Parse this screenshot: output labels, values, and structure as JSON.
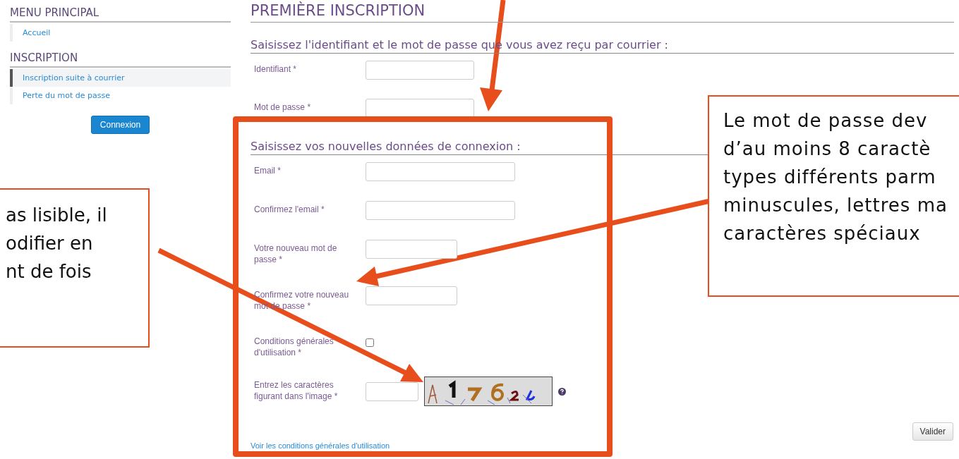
{
  "sidebar": {
    "sections": [
      {
        "title": "MENU PRINCIPAL",
        "items": [
          {
            "label": "Accueil",
            "selected": false
          }
        ]
      },
      {
        "title": "INSCRIPTION",
        "items": [
          {
            "label": "Inscription suite à courrier",
            "selected": true
          },
          {
            "label": "Perte du mot de passe",
            "selected": false
          }
        ]
      }
    ],
    "button": "Connexion"
  },
  "page_title": "PREMIÈRE INSCRIPTION",
  "sections": [
    {
      "heading": "Saisissez l'identifiant et le mot de passe que vous avez reçu par courrier :",
      "fields": [
        {
          "label": "Identifiant *",
          "kind": "login"
        },
        {
          "label": "Mot de passe *",
          "kind": "login"
        }
      ]
    },
    {
      "heading": "Saisissez vos nouvelles données de connexion :",
      "fields": [
        {
          "label": "Email *",
          "kind": "email"
        },
        {
          "label": "Confirmez l'email *",
          "kind": "email"
        },
        {
          "label": "Votre nouveau mot de passe *",
          "kind": "password"
        },
        {
          "label": "Confirmez votre nouveau mot de passe *",
          "kind": "password"
        },
        {
          "label": "Conditions générales d'utilisation *",
          "kind": "checkbox",
          "checked": false
        },
        {
          "label": "Entrez les caractères figurant dans l'image *",
          "kind": "captcha"
        }
      ]
    }
  ],
  "link": "Voir les conditions générales d'utilisation",
  "submit": "Valider",
  "callouts": [
    {
      "kind": "left",
      "lines": [
        "as lisible, il",
        "odifier en",
        "nt de fois"
      ]
    },
    {
      "kind": "right",
      "lines": [
        "Le mot de passe dev",
        "d’au moins 8 caractè",
        "types différents parm",
        "minuscules, lettres ma",
        "caractères spéciaux"
      ]
    }
  ]
}
